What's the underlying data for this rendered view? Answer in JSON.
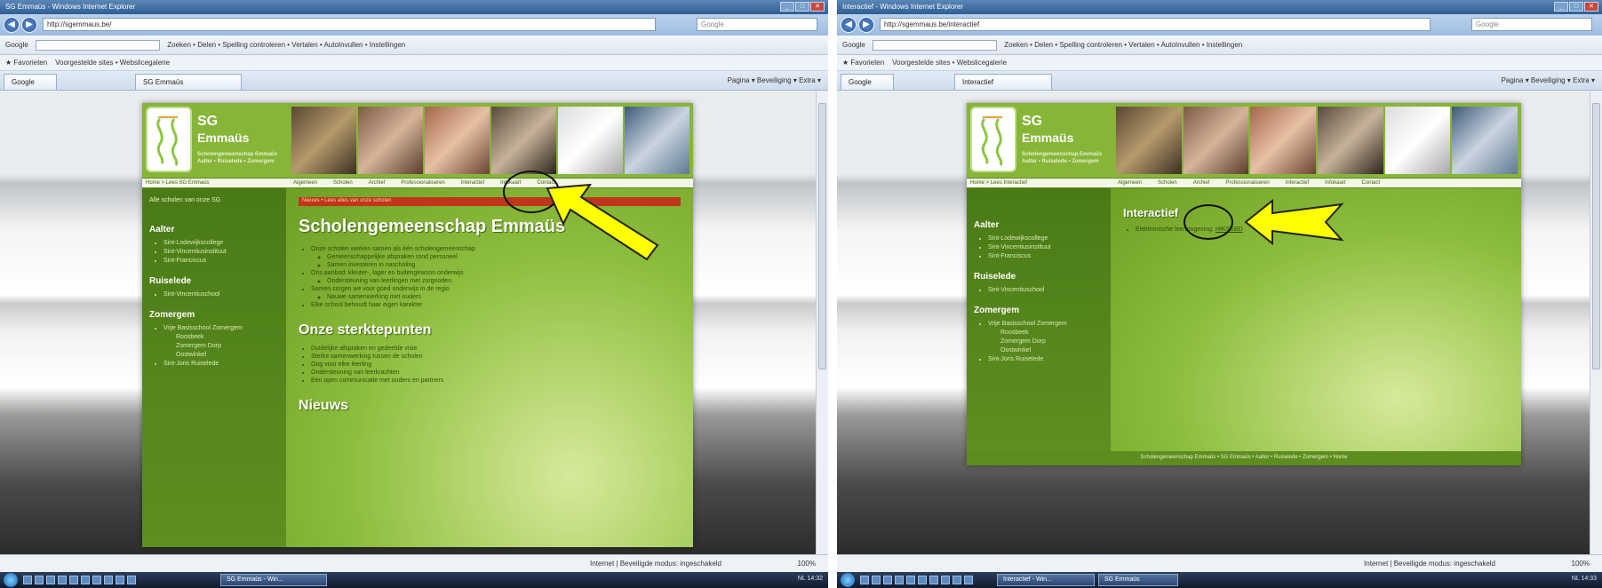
{
  "left": {
    "window_title": "SG Emmaüs - Windows Internet Explorer",
    "address": "http://sgemmaus.be/",
    "search_placeholder": "Google",
    "toolbar_text": "Google",
    "toolbar_items": "Zoeken • Delen • Spelling controleren • Vertalen • AutoInvullen • Instellingen",
    "favorites_label": "Favorieten",
    "favorites_items": "Voorgestelde sites • Webslicegalerie",
    "tab_google": "Google",
    "tab_active": "SG Emmaüs",
    "tab_icons": "Pagina ▾  Beveiliging ▾  Extra ▾",
    "brand_sg": "SG",
    "brand_name": "Emmaüs",
    "brand_tagline": "Scholengemeenschap Emmaüs Aalter • Ruiselede • Zomergem",
    "crumb": "Home > Lees SG Emmaüs",
    "menu": [
      "Algemeen",
      "Scholen",
      "Archief",
      "Professionaliseren",
      "Interactief",
      "Infokaart",
      "Contact"
    ],
    "sidebar_top": "Alle scholen van onze SG",
    "sidebar_sections": [
      {
        "title": "Aalter",
        "items": [
          "Sint-Lodewijkscollege",
          "Sint-Vincentiusinstituut",
          "Sint-Franciscus"
        ]
      },
      {
        "title": "Ruiselede",
        "items": [
          "Sint-Vincentiuschool"
        ]
      },
      {
        "title": "Zomergem",
        "items": [
          "Vrije Basisschool Zomergem",
          "Roosbeek",
          "Zomergem Dorp",
          "Oostwinkel",
          "Sint-Joris Ruiselede"
        ]
      }
    ],
    "alert": "Nieuws • Lees alles van onze scholen",
    "heading": "Scholengemeenschap Emmaüs",
    "intro_bullets": [
      "Onze scholen werken samen als één scholengemeenschap",
      "Ons aanbod: kleuter-, lager en buitengewoon onderwijs",
      "Samen zorgen we voor goed onderwijs in de regio",
      "Elke school behoudt haar eigen karakter"
    ],
    "intro_subbullets": [
      "Gemeenschappelijke afspraken rond personeel",
      "Samen investeren in nascholing",
      "Ondersteuning van leerlingen met zorgnoden",
      "Nauwe samenwerking met ouders"
    ],
    "strengths_heading": "Onze sterktepunten",
    "strengths_bullets": [
      "Duidelijke afspraken en gedeelde visie",
      "Sterke samenwerking tussen de scholen",
      "Oog voor elke leerling",
      "Ondersteuning van leerkrachten",
      "Een open communicatie met ouders en partners"
    ],
    "news_heading": "Nieuws",
    "status_zone": "Internet | Beveiligde modus: ingeschakeld",
    "zoom": "100%",
    "taskbar_btn1": "SG Emmaüs - Win...",
    "tray": "NL  14:32"
  },
  "right": {
    "window_title": "Interactief - Windows Internet Explorer",
    "address": "http://sgemmaus.be/interactief",
    "search_placeholder": "Google",
    "toolbar_text": "Google",
    "toolbar_items": "Zoeken • Delen • Spelling controleren • Vertalen • AutoInvullen • Instellingen",
    "favorites_label": "Favorieten",
    "favorites_items": "Voorgestelde sites • Webslicegalerie",
    "tab_google": "Google",
    "tab_active": "Interactief",
    "tab_icons": "Pagina ▾  Beveiliging ▾  Extra ▾",
    "brand_sg": "SG",
    "brand_name": "Emmaüs",
    "brand_tagline": "Scholengemeenschap Emmaüs Aalter • Ruiselede • Zomergem",
    "crumb": "Home > Lees Interactief",
    "menu": [
      "Algemeen",
      "Scholen",
      "Archief",
      "Professionaliseren",
      "Interactief",
      "Infokaart",
      "Contact"
    ],
    "sidebar_sections": [
      {
        "title": "Aalter",
        "items": [
          "Sint-Lodewijkscollege",
          "Sint-Vincentiusinstituut",
          "Sint-Franciscus"
        ]
      },
      {
        "title": "Ruiselede",
        "items": [
          "Sint-Vincentiuschool"
        ]
      },
      {
        "title": "Zomergem",
        "items": [
          "Vrije Basisschool Zomergem",
          "Roosbeek",
          "Zomergem Dorp",
          "Oostwinkel",
          "Sint-Joris Ruiselede"
        ]
      }
    ],
    "heading": "Interactief",
    "bullet_text": "Elektronische leeromgeving:",
    "bullet_link": "HIKSSBD",
    "footer": "Scholengemeenschap Emmaüs • SG Emmaüs • Aalter • Ruiselede • Zomergem • Home",
    "status_zone": "Internet | Beveiligde modus: ingeschakeld",
    "zoom": "100%",
    "taskbar_btn1": "Interactief - Win...",
    "taskbar_btn2": "SG Emmaüs",
    "tray": "NL  14:33"
  },
  "colors": {
    "site_green": "#7aab2e",
    "sidebar_green": "#4a7a16",
    "alert_red": "#c0351b",
    "arrow_yellow": "#ffff00"
  }
}
